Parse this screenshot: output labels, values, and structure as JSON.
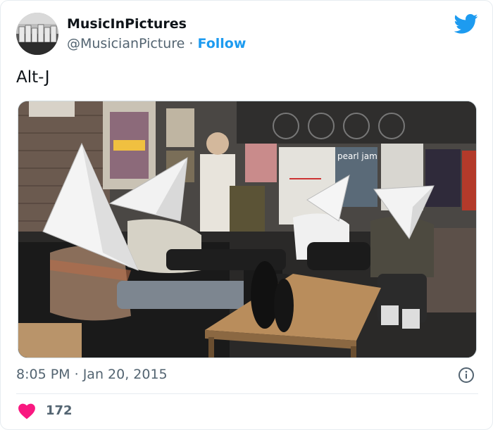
{
  "tweet": {
    "author": {
      "display_name": "MusicInPictures",
      "handle": "@MusicianPicture",
      "separator": "·",
      "follow_label": "Follow",
      "avatar_icon": "record-crates-avatar"
    },
    "platform_icon": "twitter-bird-icon",
    "text": "Alt-J",
    "image": {
      "description_icon": "band-photo",
      "poster_text": "pearl jam"
    },
    "timestamp": {
      "time": "8:05 PM",
      "separator": "·",
      "date": "Jan 20, 2015"
    },
    "likes": {
      "count": "172",
      "icon": "heart-icon"
    }
  },
  "colors": {
    "brand_blue": "#1d9bf0",
    "like_red": "#f91880",
    "secondary_text": "#536471"
  }
}
